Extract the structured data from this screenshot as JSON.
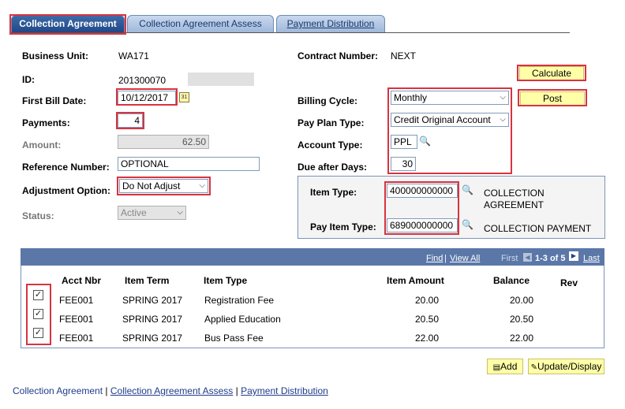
{
  "tabs": [
    {
      "label": "Collection Agreement"
    },
    {
      "label": "Collection Agreement Assess"
    },
    {
      "label": "Payment Distribution"
    }
  ],
  "form": {
    "business_unit_label": "Business Unit:",
    "business_unit_value": "WA171",
    "id_label": "ID:",
    "id_value": "201300070",
    "first_bill_date_label": "First Bill Date:",
    "first_bill_date_value": "10/12/2017",
    "calendar_icon": "calendar-icon",
    "payments_label": "Payments:",
    "payments_value": "4",
    "amount_label": "Amount:",
    "amount_value": "62.50",
    "reference_number_label": "Reference Number:",
    "reference_number_value": "OPTIONAL",
    "adjustment_option_label": "Adjustment Option:",
    "adjustment_option_value": "Do Not Adjust",
    "status_label": "Status:",
    "status_value": "Active",
    "contract_number_label": "Contract Number:",
    "contract_number_value": "NEXT",
    "billing_cycle_label": "Billing Cycle:",
    "billing_cycle_value": "Monthly",
    "pay_plan_type_label": "Pay Plan Type:",
    "pay_plan_type_value": "Credit Original Account",
    "account_type_label": "Account Type:",
    "account_type_value": "PPL",
    "due_after_days_label": "Due after Days:",
    "due_after_days_value": "30",
    "calculate_button": "Calculate",
    "post_button": "Post"
  },
  "item_box": {
    "item_type_label": "Item Type:",
    "item_type_value": "400000000000",
    "item_type_desc_line1": "COLLECTION",
    "item_type_desc_line2": "AGREEMENT",
    "pay_item_type_label": "Pay Item Type:",
    "pay_item_type_value": "689000000000",
    "pay_item_type_desc": "COLLECTION PAYMENT"
  },
  "grid": {
    "find_link": "Find",
    "view_all_link": "View All",
    "first_label": "First",
    "range_label": "1-3 of 5",
    "last_label": "Last",
    "columns": [
      "Acct Nbr",
      "Item Term",
      "Item Type",
      "Item Amount",
      "Balance",
      "Rev"
    ],
    "rows": [
      {
        "checked": true,
        "acct_nbr": "FEE001",
        "item_term": "SPRING 2017",
        "item_type": "Registration Fee",
        "item_amount": "20.00",
        "balance": "20.00"
      },
      {
        "checked": true,
        "acct_nbr": "FEE001",
        "item_term": "SPRING 2017",
        "item_type": "Applied Education",
        "item_amount": "20.50",
        "balance": "20.50"
      },
      {
        "checked": true,
        "acct_nbr": "FEE001",
        "item_term": "SPRING 2017",
        "item_type": "Bus Pass Fee",
        "item_amount": "22.00",
        "balance": "22.00"
      }
    ],
    "add_button": "Add",
    "update_button": "Update/Display"
  },
  "footer_links": [
    "Collection Agreement",
    "Collection Agreement Assess",
    "Payment Distribution"
  ],
  "colors": {
    "highlight": "#d9333f",
    "grid_header": "#5a77a8",
    "button_bg": "#ffffa8"
  }
}
